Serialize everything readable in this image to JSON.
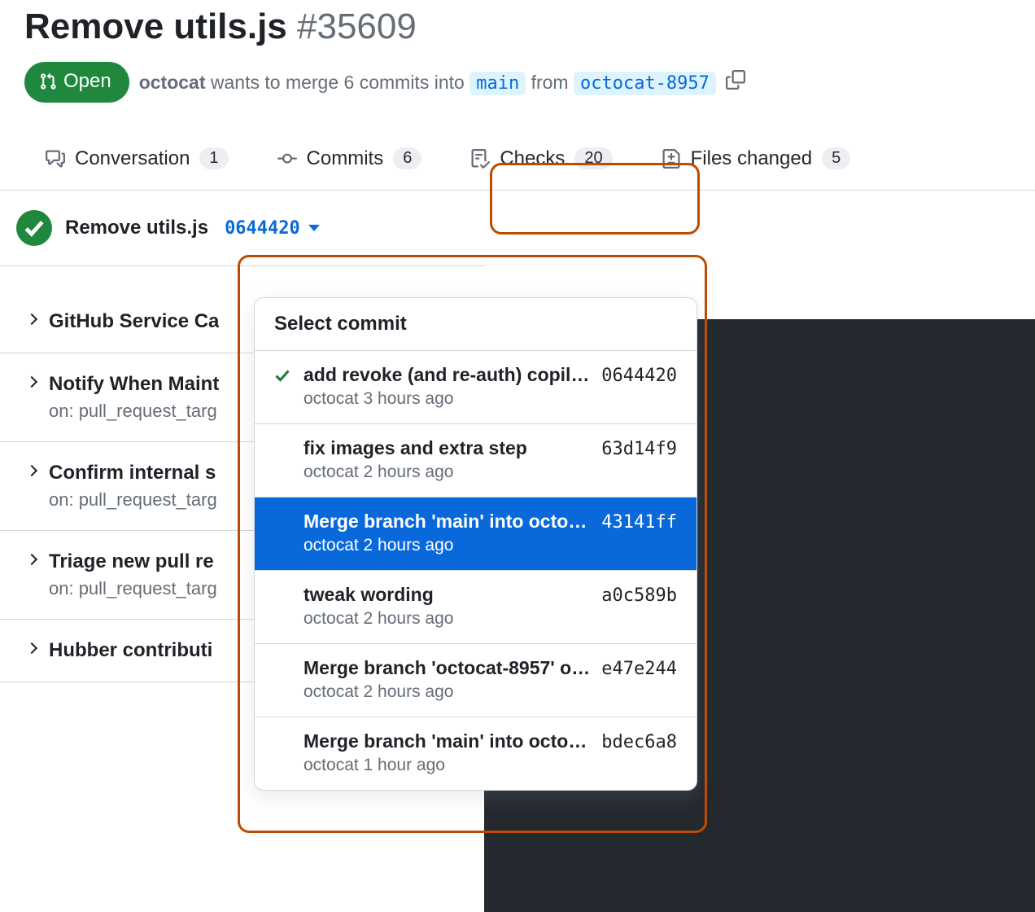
{
  "pr": {
    "title": "Remove utils.js",
    "number": "#35609",
    "state": "Open",
    "author": "octocat",
    "merge_text_pre": " wants to merge 6 commits into ",
    "base_branch": "main",
    "merge_text_mid": " from ",
    "head_branch": "octocat-8957"
  },
  "tabs": {
    "conversation": {
      "label": "Conversation",
      "count": "1"
    },
    "commits": {
      "label": "Commits",
      "count": "6"
    },
    "checks": {
      "label": "Checks",
      "count": "20"
    },
    "files": {
      "label": "Files changed",
      "count": "5"
    }
  },
  "checks_header": {
    "title": "Remove utils.js",
    "selected_sha": "0644420"
  },
  "check_groups": [
    {
      "label": "GitHub Service Ca",
      "sub": ""
    },
    {
      "label": "Notify When Maint",
      "sub": "on: pull_request_targ"
    },
    {
      "label": "Confirm internal s",
      "sub": "on: pull_request_targ"
    },
    {
      "label": "Triage new pull re",
      "sub": "on: pull_request_targ"
    },
    {
      "label": "Hubber contributi",
      "sub": ""
    }
  ],
  "commit_menu": {
    "header": "Select commit",
    "items": [
      {
        "msg": "add revoke (and re-auth) copilo…",
        "author": "octocat",
        "time": "3 hours ago",
        "sha": "0644420",
        "checked": true,
        "selected": false
      },
      {
        "msg": "fix images and extra step",
        "author": "octocat",
        "time": "2 hours ago",
        "sha": "63d14f9",
        "checked": false,
        "selected": false
      },
      {
        "msg": "Merge branch 'main' into octoc…",
        "author": "octocat",
        "time": "2 hours ago",
        "sha": "43141ff",
        "checked": false,
        "selected": true
      },
      {
        "msg": "tweak wording",
        "author": "octocat",
        "time": "2 hours ago",
        "sha": "a0c589b",
        "checked": false,
        "selected": false
      },
      {
        "msg": "Merge branch 'octocat-8957' o…",
        "author": "octocat",
        "time": "2 hours ago",
        "sha": "e47e244",
        "checked": false,
        "selected": false
      },
      {
        "msg": "Merge branch 'main' into octoc…",
        "author": "octocat",
        "time": "1 hour ago",
        "sha": "bdec6a8",
        "checked": false,
        "selected": false
      }
    ]
  }
}
